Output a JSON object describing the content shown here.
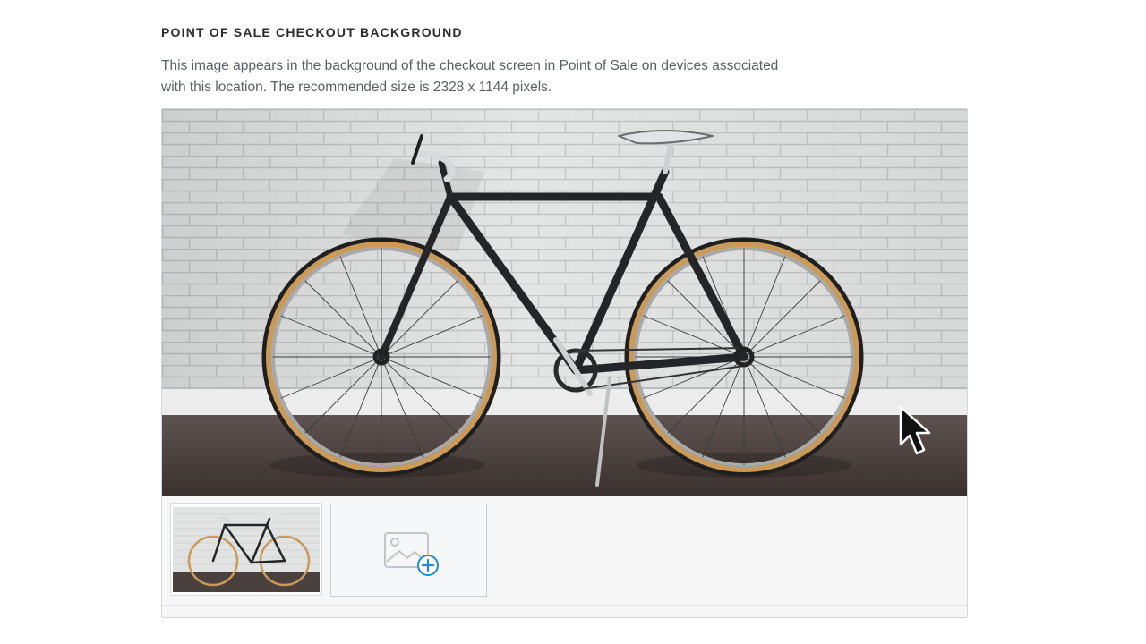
{
  "section": {
    "title": "POINT OF SALE CHECKOUT BACKGROUND",
    "description": "This image appears in the background of the checkout screen in Point of Sale on devices associated with this location. The recommended size is 2328 x 1144 pixels."
  },
  "images": {
    "preview_icon": "bicycle-photo",
    "thumbnails": [
      {
        "icon": "bicycle-photo",
        "selected": true
      }
    ],
    "upload_tile_icon": "add-image-icon"
  },
  "colors": {
    "accent": "#1f8ad0",
    "tile_border": "#c9ccd0",
    "panel_bg": "#f7f7f8"
  }
}
